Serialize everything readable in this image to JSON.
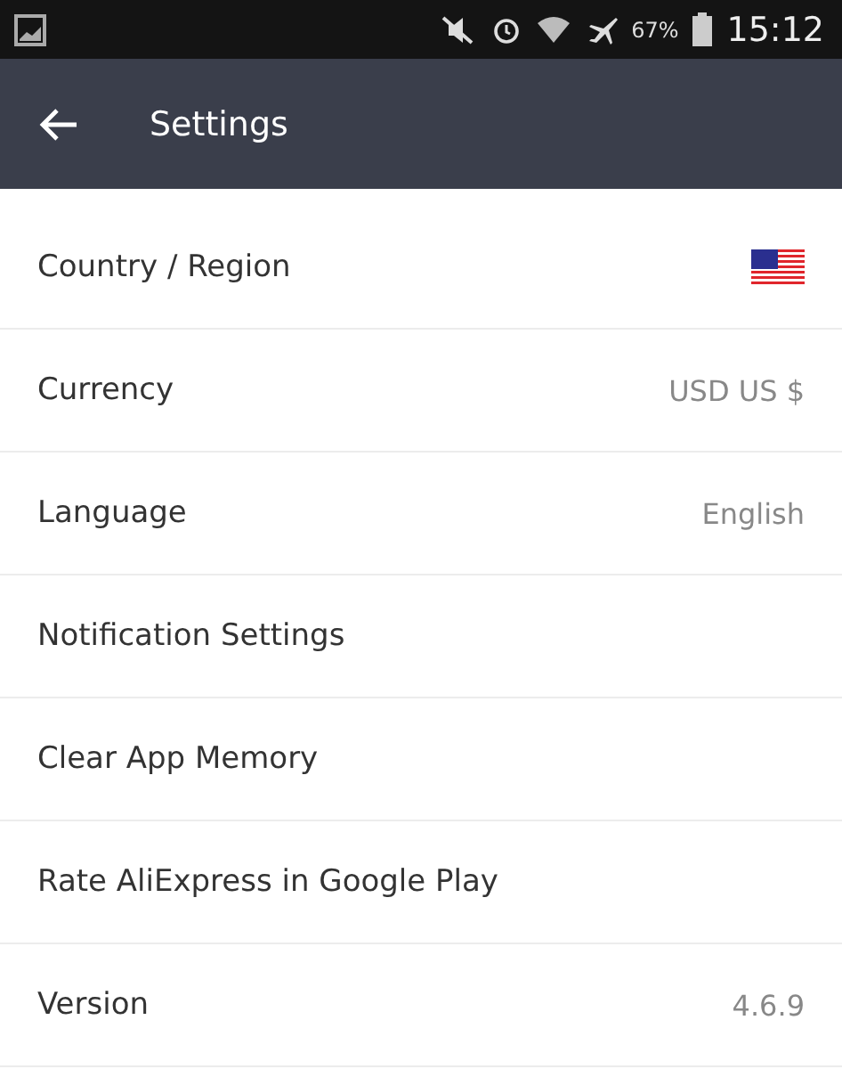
{
  "status_bar": {
    "battery": "67%",
    "time": "15:12"
  },
  "app_bar": {
    "title": "Settings"
  },
  "settings": [
    {
      "label": "Country / Region",
      "kind": "flag"
    },
    {
      "label": "Currency",
      "kind": "value",
      "value": "USD US $"
    },
    {
      "label": "Language",
      "kind": "value",
      "value": "English"
    },
    {
      "label": "Notification Settings",
      "kind": "plain"
    },
    {
      "label": "Clear App Memory",
      "kind": "plain"
    },
    {
      "label": "Rate AliExpress in Google Play",
      "kind": "plain"
    },
    {
      "label": "Version",
      "kind": "value",
      "value": "4.6.9"
    }
  ]
}
